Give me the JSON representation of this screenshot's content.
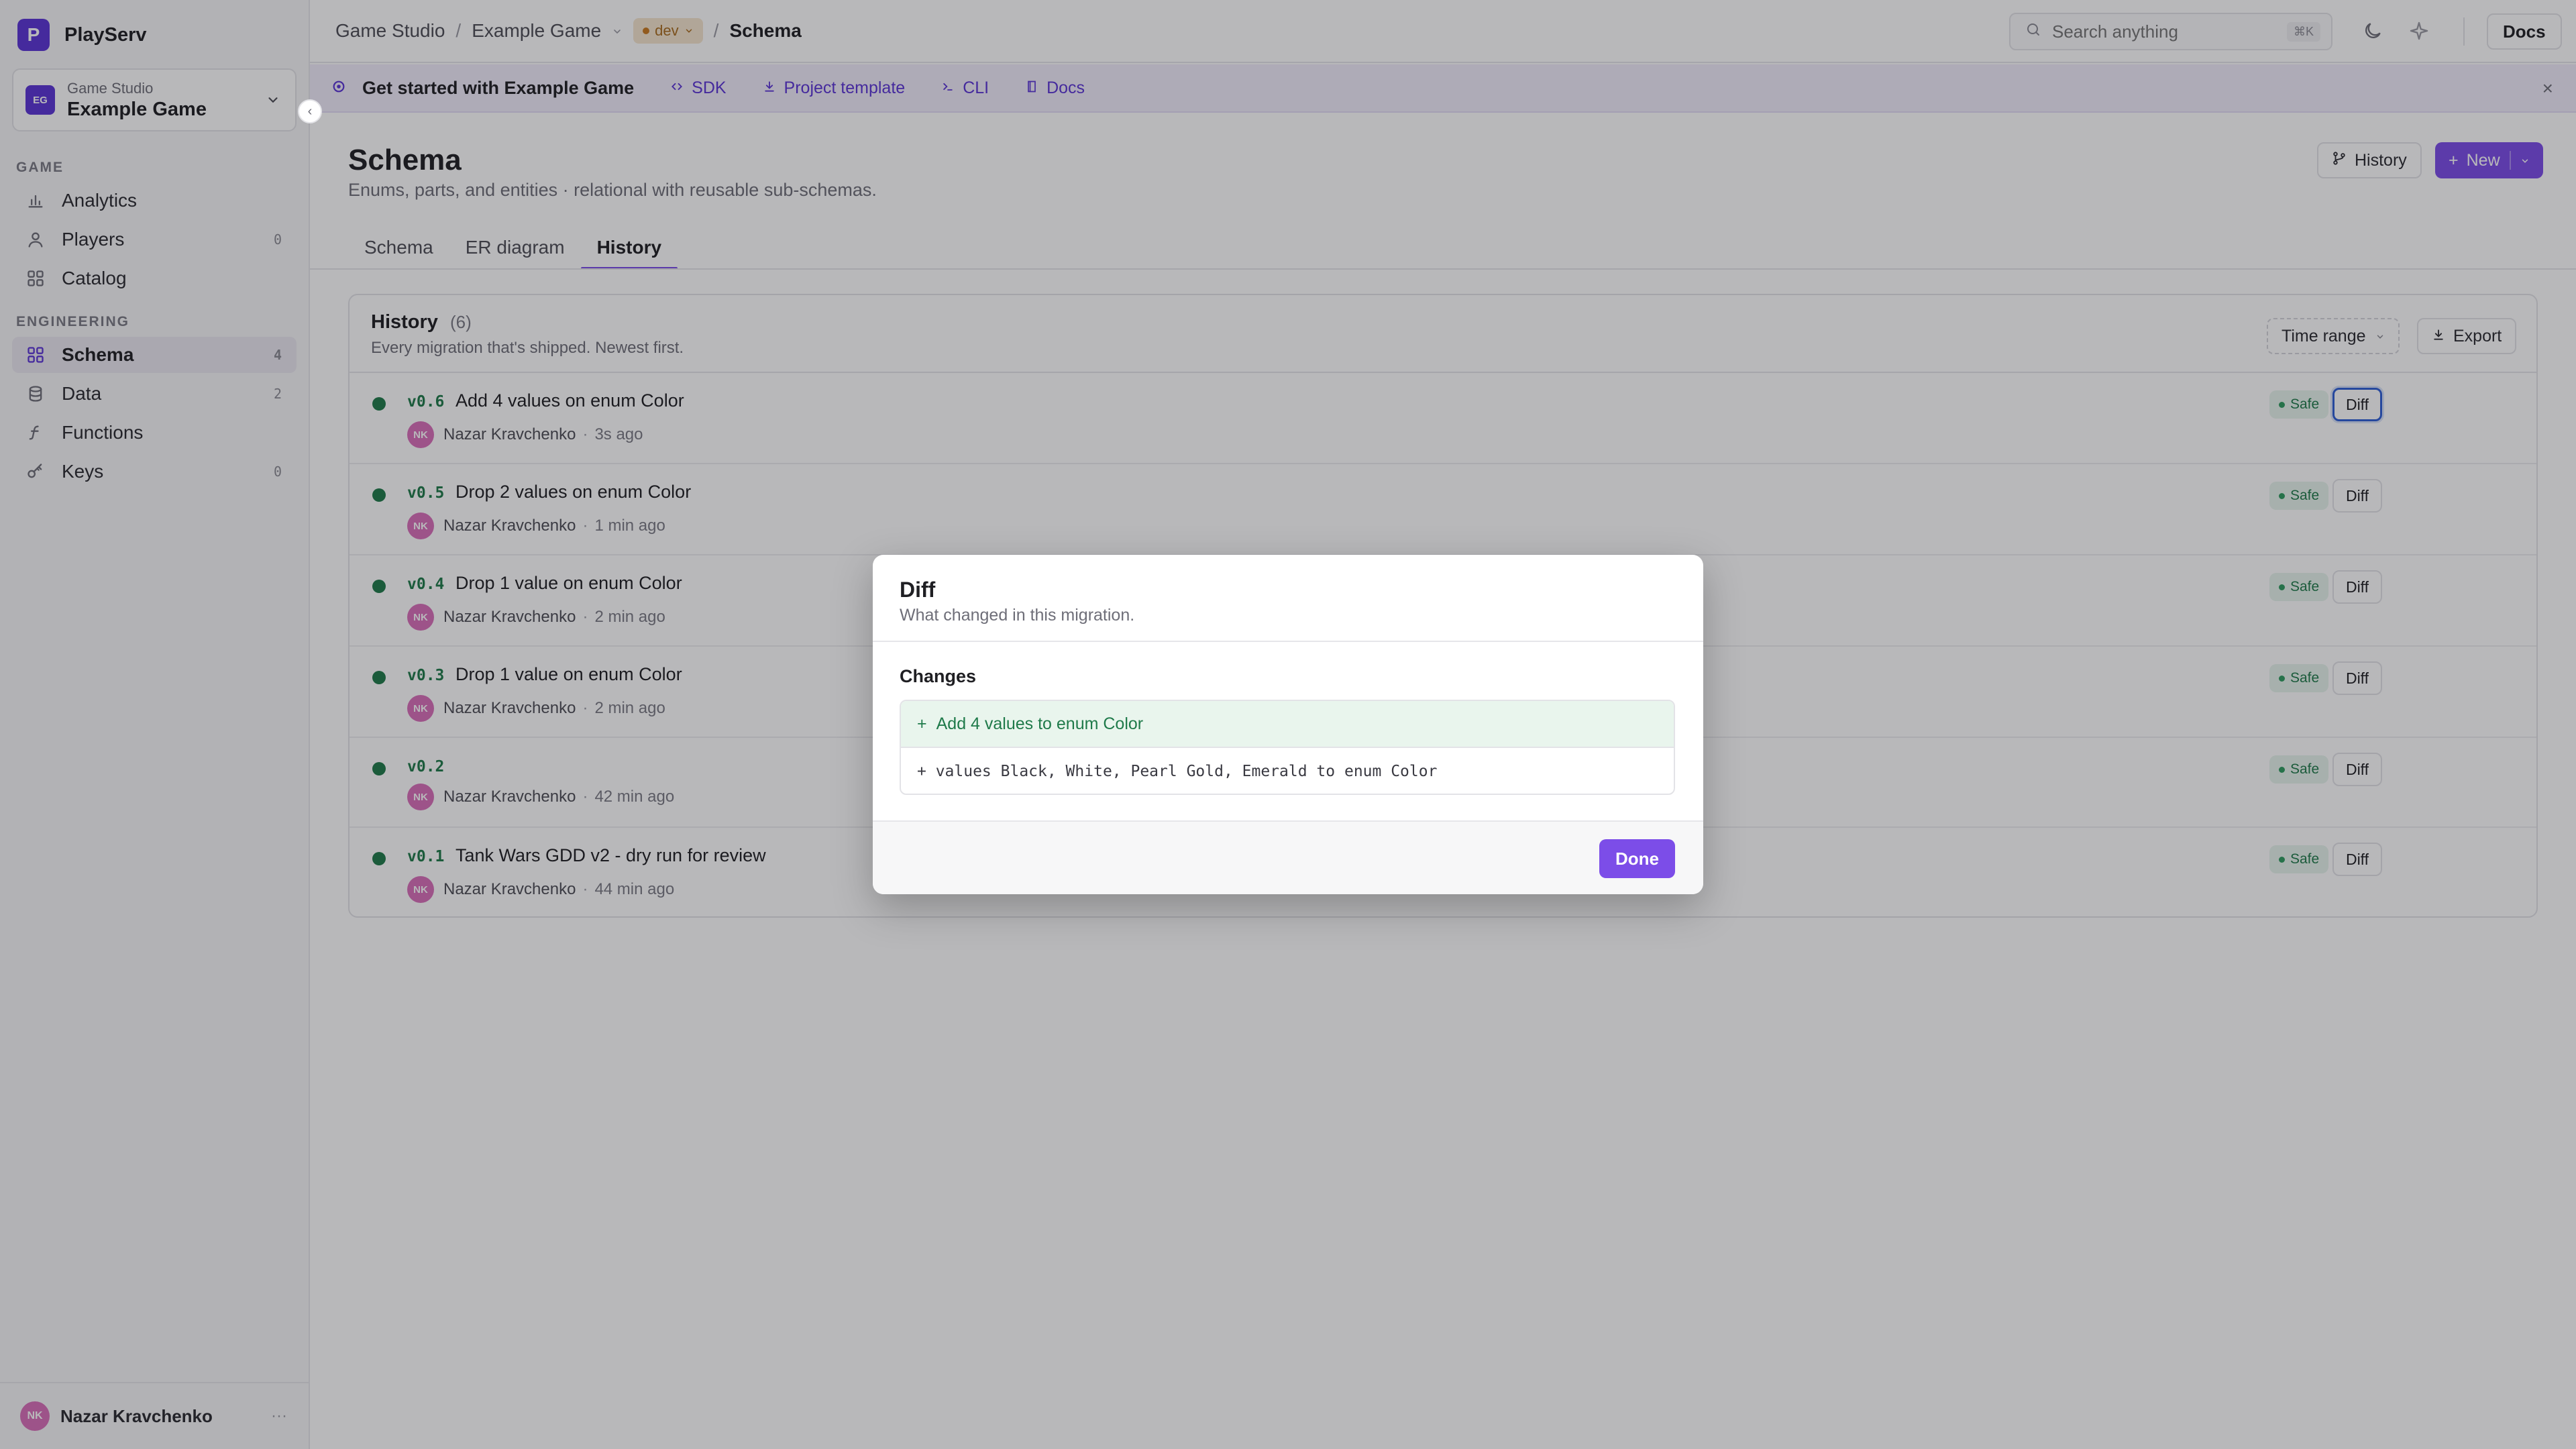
{
  "app": {
    "name": "PlayServ",
    "logo_letter": "P"
  },
  "project": {
    "org": "Game Studio",
    "name": "Example Game",
    "initials": "EG"
  },
  "sidebar": {
    "sections": [
      {
        "title": "GAME",
        "items": [
          {
            "label": "Analytics",
            "icon": "bar-chart-icon",
            "count": ""
          },
          {
            "label": "Players",
            "icon": "user-icon",
            "count": "0"
          },
          {
            "label": "Catalog",
            "icon": "grid-icon",
            "count": ""
          }
        ]
      },
      {
        "title": "ENGINEERING",
        "items": [
          {
            "label": "Schema",
            "icon": "grid-icon",
            "count": "4",
            "active": true
          },
          {
            "label": "Data",
            "icon": "database-icon",
            "count": "2"
          },
          {
            "label": "Functions",
            "icon": "function-icon",
            "count": ""
          },
          {
            "label": "Keys",
            "icon": "key-icon",
            "count": "0"
          }
        ]
      }
    ],
    "user": {
      "name": "Nazar Kravchenko",
      "initials": "NK"
    }
  },
  "breadcrumb": {
    "org": "Game Studio",
    "project": "Example Game",
    "env": "dev",
    "page": "Schema",
    "sep": "/"
  },
  "search": {
    "placeholder": "Search anything",
    "shortcut": "⌘K"
  },
  "topbar": {
    "docs_label": "Docs"
  },
  "banner": {
    "title": "Get started with Example Game",
    "links": [
      {
        "label": "SDK",
        "icon": "code-icon"
      },
      {
        "label": "Project template",
        "icon": "download-icon"
      },
      {
        "label": "CLI",
        "icon": "terminal-icon"
      },
      {
        "label": "Docs",
        "icon": "book-icon"
      }
    ]
  },
  "page": {
    "title": "Schema",
    "subtitle": "Enums, parts, and entities · relational with reusable sub-schemas.",
    "history_button": "History",
    "new_button": "New"
  },
  "tabs": [
    {
      "label": "Schema"
    },
    {
      "label": "ER diagram"
    },
    {
      "label": "History",
      "active": true
    }
  ],
  "history": {
    "title": "History",
    "count": "(6)",
    "subtitle": "Every migration that's shipped. Newest first.",
    "time_range_label": "Time range",
    "export_label": "Export",
    "safe_label": "Safe",
    "diff_label": "Diff",
    "rows": [
      {
        "version": "v0.6",
        "title": "Add 4 values on enum Color",
        "author": "Nazar Kravchenko",
        "initials": "NK",
        "time": "3s ago"
      },
      {
        "version": "v0.5",
        "title": "Drop 2 values on enum Color",
        "author": "Nazar Kravchenko",
        "initials": "NK",
        "time": "1 min ago"
      },
      {
        "version": "v0.4",
        "title": "Drop 1 value on enum Color",
        "author": "Nazar Kravchenko",
        "initials": "NK",
        "time": "2 min ago"
      },
      {
        "version": "v0.3",
        "title": "Drop 1 value on enum Color",
        "author": "Nazar Kravchenko",
        "initials": "NK",
        "time": "2 min ago"
      },
      {
        "version": "v0.2",
        "title": "",
        "author": "Nazar Kravchenko",
        "initials": "NK",
        "time": "42 min ago"
      },
      {
        "version": "v0.1",
        "title": "Tank Wars GDD v2 - dry run for review",
        "author": "Nazar Kravchenko",
        "initials": "NK",
        "time": "44 min ago"
      }
    ]
  },
  "modal": {
    "title": "Diff",
    "subtitle": "What changed in this migration.",
    "changes_label": "Changes",
    "change_summary": "Add 4 values to enum Color",
    "change_prefix": "+",
    "change_detail": "+ values Black, White, Pearl Gold, Emerald to enum Color",
    "done_label": "Done"
  },
  "colors": {
    "accent": "#7c4de8",
    "brand": "#5b34d6",
    "success": "#1f7a4a",
    "env": "#c9791f"
  }
}
